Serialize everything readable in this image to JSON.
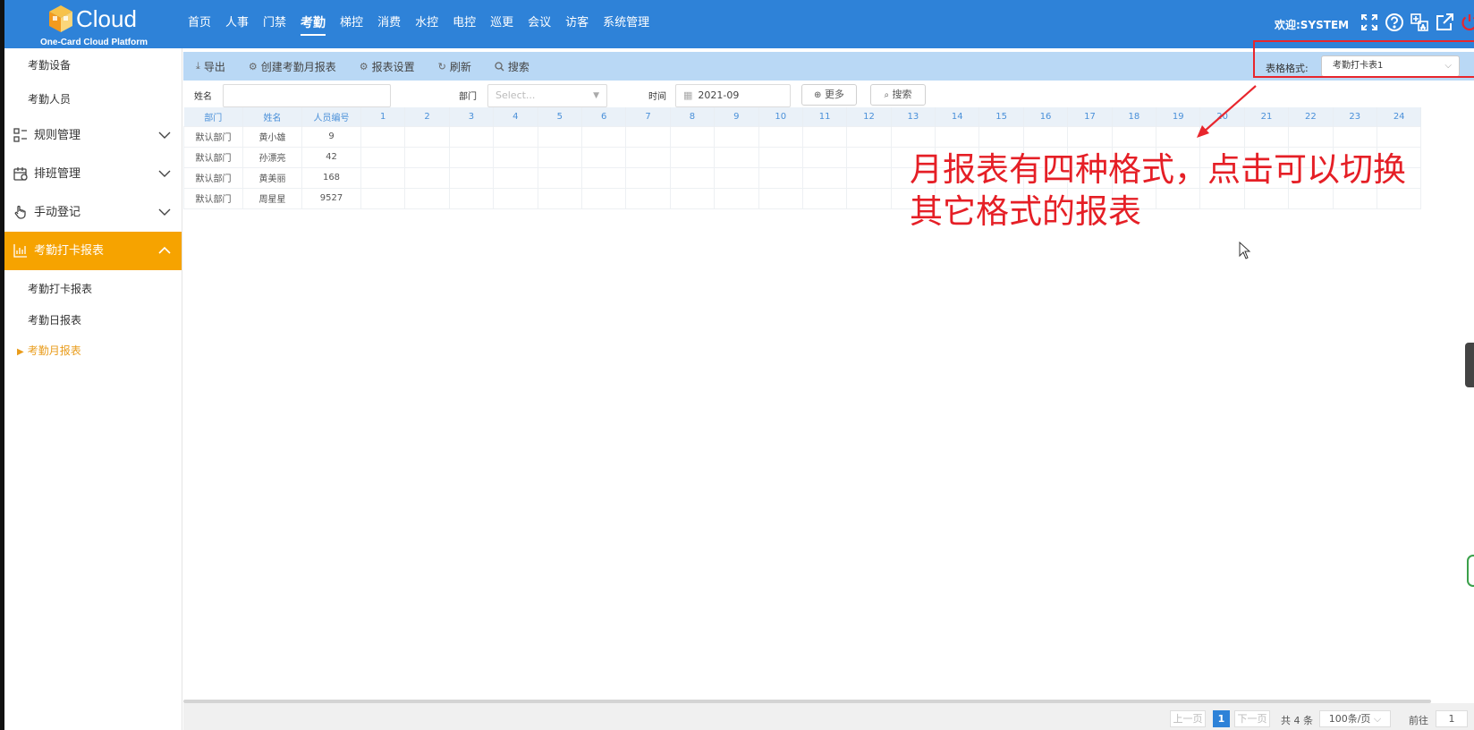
{
  "header": {
    "logo_text": "Cloud",
    "logo_sub": "One-Card Cloud Platform",
    "nav": [
      "首页",
      "人事",
      "门禁",
      "考勤",
      "梯控",
      "消费",
      "水控",
      "电控",
      "巡更",
      "会议",
      "访客",
      "系统管理"
    ],
    "active_nav": "考勤",
    "welcome": "欢迎:SYSTEM",
    "icons": [
      "fullscreen-icon",
      "help-icon",
      "language-icon",
      "external-link-icon",
      "power-icon"
    ]
  },
  "sidebar": {
    "top_items": [
      "考勤设备",
      "考勤人员"
    ],
    "groups": [
      {
        "label": "规则管理",
        "icon": "rules-icon"
      },
      {
        "label": "排班管理",
        "icon": "calendar-icon"
      },
      {
        "label": "手动登记",
        "icon": "hand-icon"
      },
      {
        "label": "考勤打卡报表",
        "icon": "chart-icon"
      }
    ],
    "sub_items": [
      "考勤打卡报表",
      "考勤日报表",
      "考勤月报表"
    ],
    "current": "考勤月报表"
  },
  "toolbar": {
    "export": "导出",
    "create": "创建考勤月报表",
    "settings": "报表设置",
    "refresh": "刷新",
    "search": "搜索",
    "format_label": "表格格式:",
    "format_value": "考勤打卡表1"
  },
  "filters": {
    "name_label": "姓名",
    "dept_label": "部门",
    "dept_placeholder": "Select...",
    "time_label": "时间",
    "time_value": "2021-09",
    "more": "更多",
    "search": "搜索"
  },
  "table": {
    "columns": [
      "部门",
      "姓名",
      "人员编号",
      "1",
      "2",
      "3",
      "4",
      "5",
      "6",
      "7",
      "8",
      "9",
      "10",
      "11",
      "12",
      "13",
      "14",
      "15",
      "16",
      "17",
      "18",
      "19",
      "20",
      "21",
      "22",
      "23",
      "24"
    ],
    "rows": [
      [
        "默认部门",
        "黄小雄",
        "9"
      ],
      [
        "默认部门",
        "孙漂亮",
        "42"
      ],
      [
        "默认部门",
        "黄美丽",
        "168"
      ],
      [
        "默认部门",
        "周星星",
        "9527"
      ]
    ]
  },
  "annotation": {
    "line1": "月报表有四种格式，点击可以切换",
    "line2": "其它格式的报表",
    "color": "#e51f26"
  },
  "pagination": {
    "prev": "上一页",
    "current": "1",
    "next": "下一页",
    "total": "共 4 条",
    "page_size": "100条/页",
    "goto_label": "前往",
    "goto_value": "1"
  },
  "colors": {
    "primary": "#2e82d8",
    "accent": "#f6a300",
    "toolbar": "#b9d8f5"
  }
}
